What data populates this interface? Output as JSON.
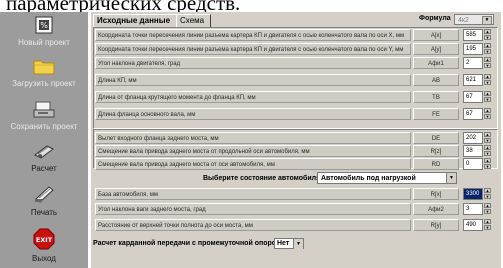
{
  "caption": "параметрических средств.",
  "sidebar": {
    "items": [
      {
        "label": "Новый проект",
        "icon": "new-project-icon"
      },
      {
        "label": "Загрузить проект",
        "icon": "folder-icon"
      },
      {
        "label": "Сохранить проект",
        "icon": "save-icon"
      },
      {
        "label": "Расчет",
        "icon": "calc-icon"
      },
      {
        "label": "Печать",
        "icon": "print-icon"
      },
      {
        "label": "Выход",
        "icon": "exit-icon",
        "icon_text": "EXIT"
      }
    ]
  },
  "tabs": [
    {
      "label": "Исходные данные",
      "active": true
    },
    {
      "label": "Схема",
      "active": false
    }
  ],
  "formula": {
    "label": "Формула",
    "value": "4к2"
  },
  "rows_group1": [
    {
      "label": "Координата точки пересечения линии разъема картера КП и двигателя с осью коленчатого вала по оси X, мм",
      "symbol": "А[х]",
      "value": "585"
    },
    {
      "label": "Координата точки пересечения линии разъема картера КП и двигателя с осью коленчатого вала по оси Y, мм",
      "symbol": "А[у]",
      "value": "195"
    },
    {
      "label": "Угол наклона двигателя, град",
      "symbol": "Афи1",
      "value": "2"
    },
    {
      "label": "Длина КП, мм",
      "symbol": "АВ",
      "value": "621"
    },
    {
      "label": "Длина от фланца крутящего момента до фланца КП, мм",
      "symbol": "ТВ",
      "value": "67"
    },
    {
      "label": "Длина фланца основного вала, мм",
      "symbol": "FE",
      "value": "67"
    }
  ],
  "rows_group2": [
    {
      "label": "Вылет входного фланца заднего моста, мм",
      "symbol": "DE",
      "value": "202"
    },
    {
      "label": "Смещение вала привода заднего моста от продольной оси автомобиля, мм",
      "symbol": "R[z]",
      "value": "38"
    },
    {
      "label": "Смещение вала привода заднего моста от оси автомобиля, мм",
      "symbol": "RD",
      "value": "0"
    }
  ],
  "state_select": {
    "label": "Выберите состояние автомобиля:",
    "value": "Автомобиль под нагрузкой"
  },
  "rows_group3": [
    {
      "label": "База автомобиля, мм",
      "symbol": "R[x]",
      "value": "3300",
      "selected": true
    },
    {
      "label": "Угол наклона ваги заднего моста, град",
      "symbol": "Афи2",
      "value": "3"
    },
    {
      "label": "Расстояние от верхней точки полнота до оси моста, мм",
      "symbol": "R[y]",
      "value": "490"
    }
  ],
  "bottom": {
    "label": "Расчет карданной передачи с промежуточной опорой:",
    "value": "Нет"
  },
  "colors": {
    "sidebar_bg": "#9c9c9c",
    "panel_bg": "#d4d0c8",
    "selection": "#0a246a",
    "exit_red": "#cc1111"
  }
}
